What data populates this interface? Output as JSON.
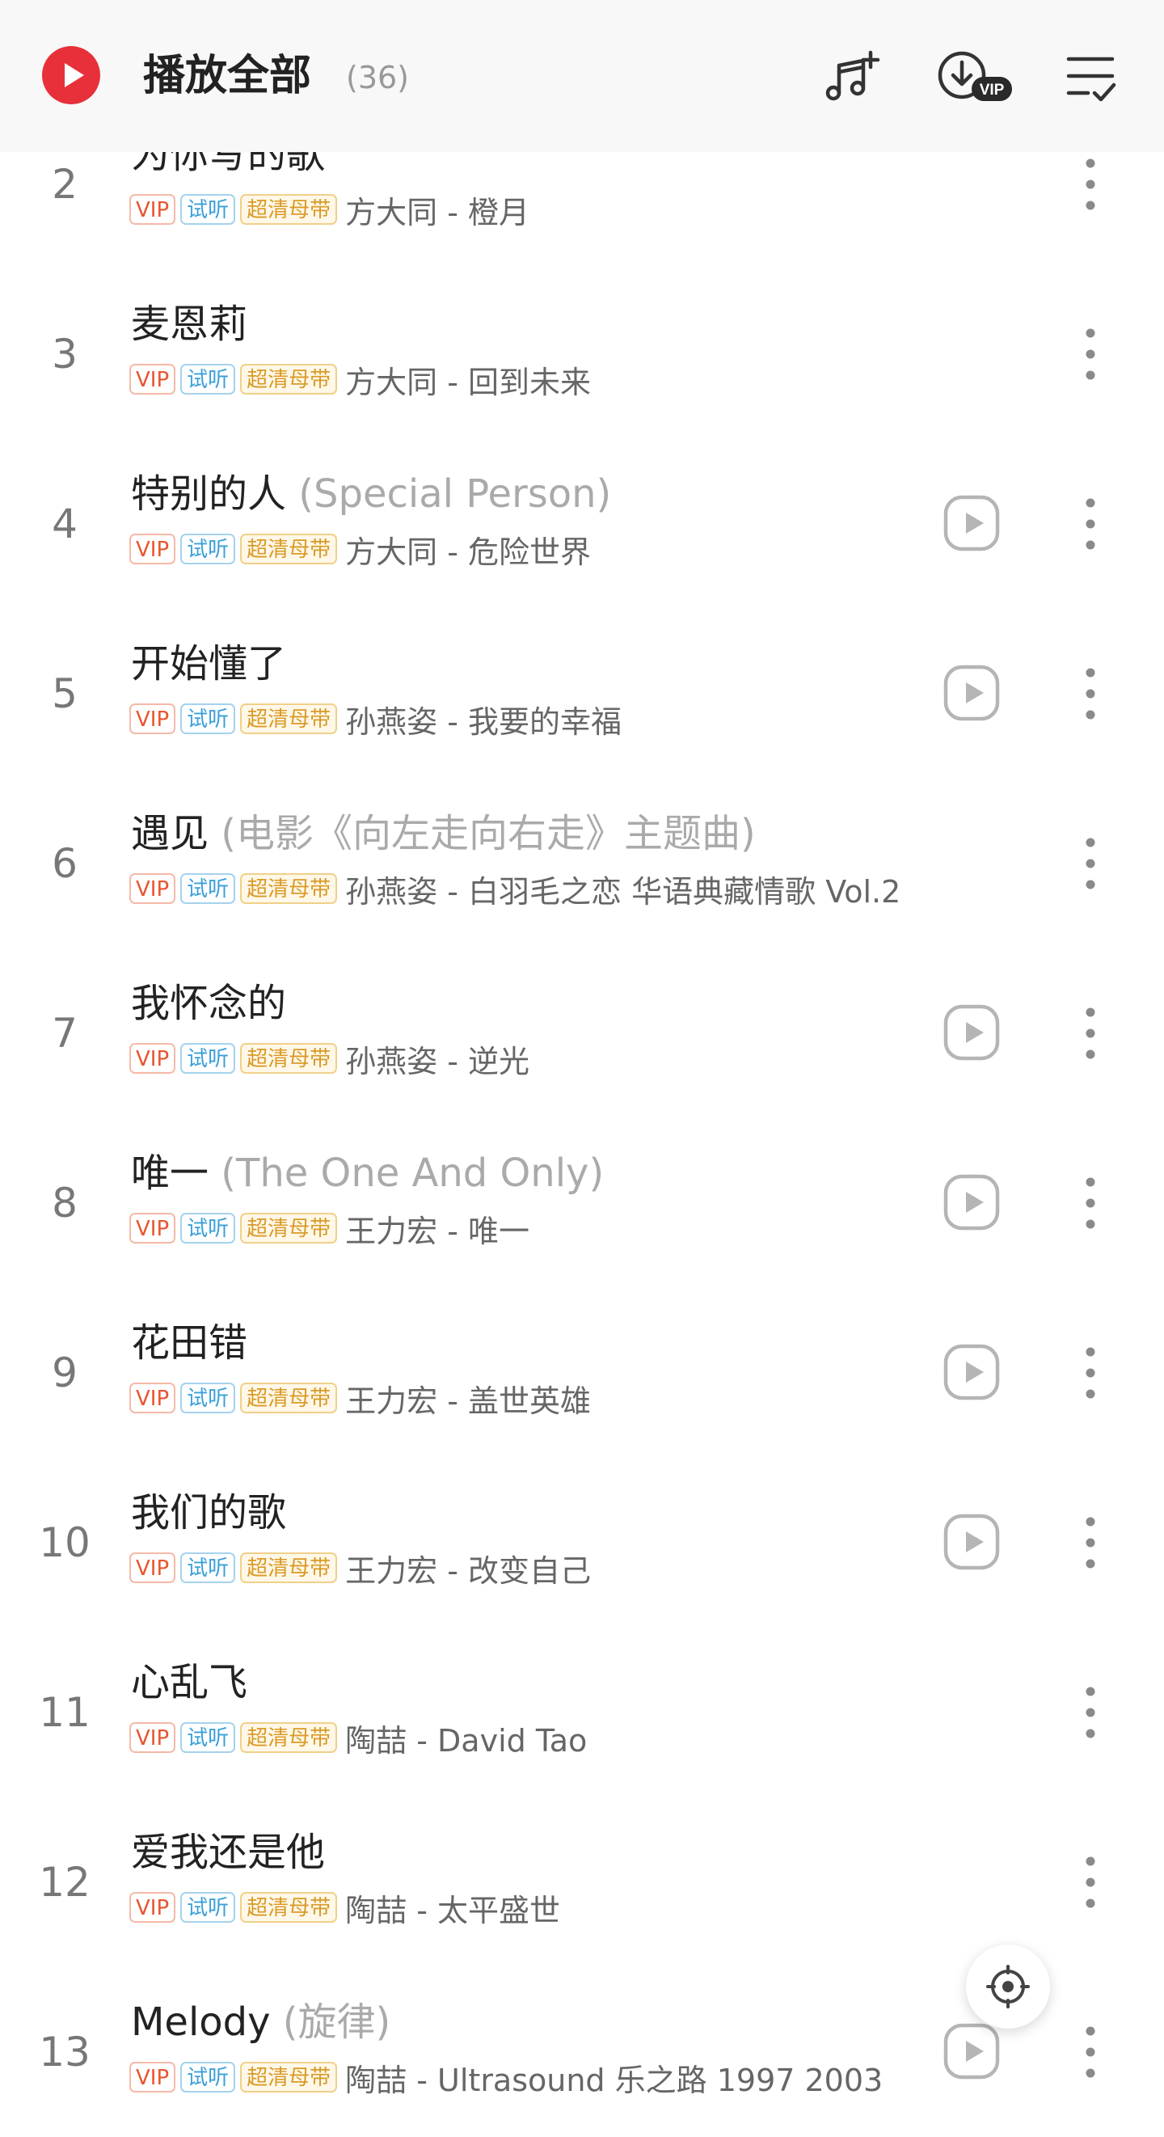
{
  "header": {
    "title": "播放全部",
    "count": "(36)",
    "icons": [
      "play-all-icon",
      "add-music-icon",
      "vip-download-icon",
      "multi-select-icon"
    ],
    "vip_badge": "VIP"
  },
  "tags": {
    "vip": "VIP",
    "trial": "试听",
    "hq": "超清母带"
  },
  "songs": [
    {
      "index": "2",
      "title": "为你写的歌",
      "subtitle": "",
      "artist": "方大同 - 橙月",
      "has_mv": false
    },
    {
      "index": "3",
      "title": "麦恩莉",
      "subtitle": "",
      "artist": "方大同 - 回到未来",
      "has_mv": false
    },
    {
      "index": "4",
      "title": "特别的人",
      "subtitle": "(Special Person)",
      "artist": "方大同 - 危险世界",
      "has_mv": true
    },
    {
      "index": "5",
      "title": "开始懂了",
      "subtitle": "",
      "artist": "孙燕姿 - 我要的幸福",
      "has_mv": true
    },
    {
      "index": "6",
      "title": "遇见",
      "subtitle": "(电影《向左走向右走》主题曲)",
      "artist": "孙燕姿 - 白羽毛之恋 华语典藏情歌 Vol.2",
      "has_mv": false
    },
    {
      "index": "7",
      "title": "我怀念的",
      "subtitle": "",
      "artist": "孙燕姿 - 逆光",
      "has_mv": true
    },
    {
      "index": "8",
      "title": "唯一",
      "subtitle": "(The One And Only)",
      "artist": "王力宏 - 唯一",
      "has_mv": true
    },
    {
      "index": "9",
      "title": "花田错",
      "subtitle": "",
      "artist": "王力宏 - 盖世英雄",
      "has_mv": true
    },
    {
      "index": "10",
      "title": "我们的歌",
      "subtitle": "",
      "artist": "王力宏 - 改变自己",
      "has_mv": true
    },
    {
      "index": "11",
      "title": "心乱飞",
      "subtitle": "",
      "artist": "陶喆 - David Tao",
      "has_mv": false
    },
    {
      "index": "12",
      "title": "爱我还是他",
      "subtitle": "",
      "artist": "陶喆 - 太平盛世",
      "has_mv": false
    },
    {
      "index": "13",
      "title": "Melody",
      "subtitle": "(旋律)",
      "artist": "陶喆 - Ultrasound 乐之路 1997 2003",
      "has_mv": true
    }
  ],
  "colors": {
    "accent_red": "#e8303a",
    "tag_vip": "#e8552f",
    "tag_trial": "#3aa0d9",
    "tag_hq": "#d99a26"
  }
}
